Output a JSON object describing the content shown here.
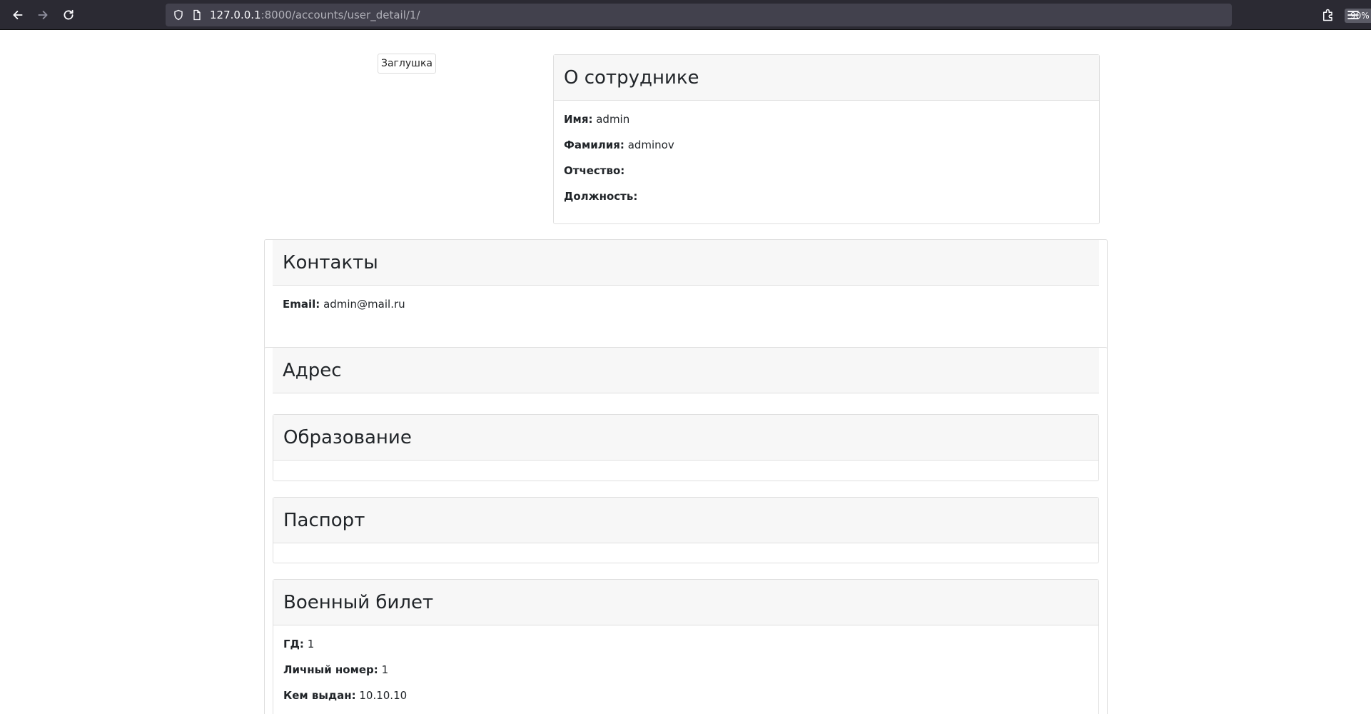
{
  "browser": {
    "url_host": "127.0.0.1",
    "url_rest": ":8000/accounts/user_detail/1/",
    "zoom": "90%"
  },
  "stub_button": "Заглушка",
  "employee": {
    "title": "О сотруднике",
    "fields": [
      {
        "label": "Имя:",
        "value": "admin"
      },
      {
        "label": "Фамилия:",
        "value": "adminov"
      },
      {
        "label": "Отчество:",
        "value": ""
      },
      {
        "label": "Должность:",
        "value": ""
      }
    ]
  },
  "contacts": {
    "title": "Контакты",
    "fields": [
      {
        "label": "Email:",
        "value": "admin@mail.ru"
      }
    ]
  },
  "address": {
    "title": "Адрес"
  },
  "education": {
    "title": "Образование"
  },
  "passport": {
    "title": "Паспорт"
  },
  "military": {
    "title": "Военный билет",
    "fields": [
      {
        "label": "ГД:",
        "value": "1"
      },
      {
        "label": "Личный номер:",
        "value": "1"
      },
      {
        "label": "Кем выдан:",
        "value": "10.10.10"
      }
    ]
  }
}
